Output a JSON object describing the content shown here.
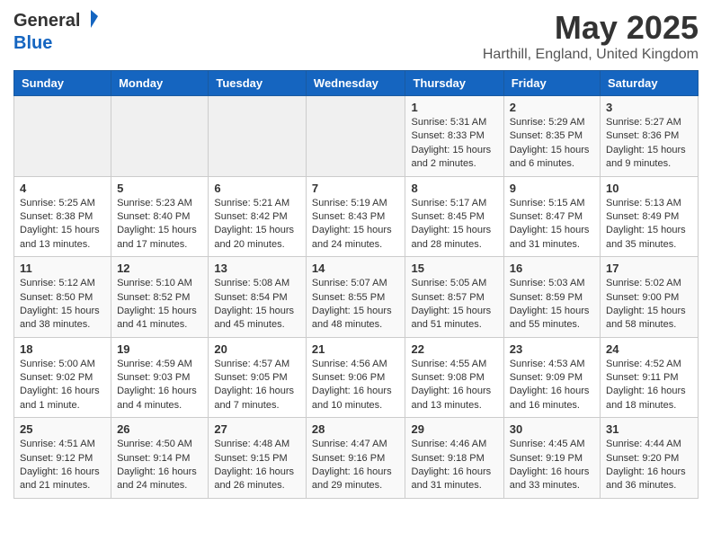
{
  "header": {
    "logo_general": "General",
    "logo_blue": "Blue",
    "month": "May 2025",
    "location": "Harthill, England, United Kingdom"
  },
  "days_of_week": [
    "Sunday",
    "Monday",
    "Tuesday",
    "Wednesday",
    "Thursday",
    "Friday",
    "Saturday"
  ],
  "weeks": [
    [
      {
        "day": "",
        "content": ""
      },
      {
        "day": "",
        "content": ""
      },
      {
        "day": "",
        "content": ""
      },
      {
        "day": "",
        "content": ""
      },
      {
        "day": "1",
        "content": "Sunrise: 5:31 AM\nSunset: 8:33 PM\nDaylight: 15 hours\nand 2 minutes."
      },
      {
        "day": "2",
        "content": "Sunrise: 5:29 AM\nSunset: 8:35 PM\nDaylight: 15 hours\nand 6 minutes."
      },
      {
        "day": "3",
        "content": "Sunrise: 5:27 AM\nSunset: 8:36 PM\nDaylight: 15 hours\nand 9 minutes."
      }
    ],
    [
      {
        "day": "4",
        "content": "Sunrise: 5:25 AM\nSunset: 8:38 PM\nDaylight: 15 hours\nand 13 minutes."
      },
      {
        "day": "5",
        "content": "Sunrise: 5:23 AM\nSunset: 8:40 PM\nDaylight: 15 hours\nand 17 minutes."
      },
      {
        "day": "6",
        "content": "Sunrise: 5:21 AM\nSunset: 8:42 PM\nDaylight: 15 hours\nand 20 minutes."
      },
      {
        "day": "7",
        "content": "Sunrise: 5:19 AM\nSunset: 8:43 PM\nDaylight: 15 hours\nand 24 minutes."
      },
      {
        "day": "8",
        "content": "Sunrise: 5:17 AM\nSunset: 8:45 PM\nDaylight: 15 hours\nand 28 minutes."
      },
      {
        "day": "9",
        "content": "Sunrise: 5:15 AM\nSunset: 8:47 PM\nDaylight: 15 hours\nand 31 minutes."
      },
      {
        "day": "10",
        "content": "Sunrise: 5:13 AM\nSunset: 8:49 PM\nDaylight: 15 hours\nand 35 minutes."
      }
    ],
    [
      {
        "day": "11",
        "content": "Sunrise: 5:12 AM\nSunset: 8:50 PM\nDaylight: 15 hours\nand 38 minutes."
      },
      {
        "day": "12",
        "content": "Sunrise: 5:10 AM\nSunset: 8:52 PM\nDaylight: 15 hours\nand 41 minutes."
      },
      {
        "day": "13",
        "content": "Sunrise: 5:08 AM\nSunset: 8:54 PM\nDaylight: 15 hours\nand 45 minutes."
      },
      {
        "day": "14",
        "content": "Sunrise: 5:07 AM\nSunset: 8:55 PM\nDaylight: 15 hours\nand 48 minutes."
      },
      {
        "day": "15",
        "content": "Sunrise: 5:05 AM\nSunset: 8:57 PM\nDaylight: 15 hours\nand 51 minutes."
      },
      {
        "day": "16",
        "content": "Sunrise: 5:03 AM\nSunset: 8:59 PM\nDaylight: 15 hours\nand 55 minutes."
      },
      {
        "day": "17",
        "content": "Sunrise: 5:02 AM\nSunset: 9:00 PM\nDaylight: 15 hours\nand 58 minutes."
      }
    ],
    [
      {
        "day": "18",
        "content": "Sunrise: 5:00 AM\nSunset: 9:02 PM\nDaylight: 16 hours\nand 1 minute."
      },
      {
        "day": "19",
        "content": "Sunrise: 4:59 AM\nSunset: 9:03 PM\nDaylight: 16 hours\nand 4 minutes."
      },
      {
        "day": "20",
        "content": "Sunrise: 4:57 AM\nSunset: 9:05 PM\nDaylight: 16 hours\nand 7 minutes."
      },
      {
        "day": "21",
        "content": "Sunrise: 4:56 AM\nSunset: 9:06 PM\nDaylight: 16 hours\nand 10 minutes."
      },
      {
        "day": "22",
        "content": "Sunrise: 4:55 AM\nSunset: 9:08 PM\nDaylight: 16 hours\nand 13 minutes."
      },
      {
        "day": "23",
        "content": "Sunrise: 4:53 AM\nSunset: 9:09 PM\nDaylight: 16 hours\nand 16 minutes."
      },
      {
        "day": "24",
        "content": "Sunrise: 4:52 AM\nSunset: 9:11 PM\nDaylight: 16 hours\nand 18 minutes."
      }
    ],
    [
      {
        "day": "25",
        "content": "Sunrise: 4:51 AM\nSunset: 9:12 PM\nDaylight: 16 hours\nand 21 minutes."
      },
      {
        "day": "26",
        "content": "Sunrise: 4:50 AM\nSunset: 9:14 PM\nDaylight: 16 hours\nand 24 minutes."
      },
      {
        "day": "27",
        "content": "Sunrise: 4:48 AM\nSunset: 9:15 PM\nDaylight: 16 hours\nand 26 minutes."
      },
      {
        "day": "28",
        "content": "Sunrise: 4:47 AM\nSunset: 9:16 PM\nDaylight: 16 hours\nand 29 minutes."
      },
      {
        "day": "29",
        "content": "Sunrise: 4:46 AM\nSunset: 9:18 PM\nDaylight: 16 hours\nand 31 minutes."
      },
      {
        "day": "30",
        "content": "Sunrise: 4:45 AM\nSunset: 9:19 PM\nDaylight: 16 hours\nand 33 minutes."
      },
      {
        "day": "31",
        "content": "Sunrise: 4:44 AM\nSunset: 9:20 PM\nDaylight: 16 hours\nand 36 minutes."
      }
    ]
  ]
}
